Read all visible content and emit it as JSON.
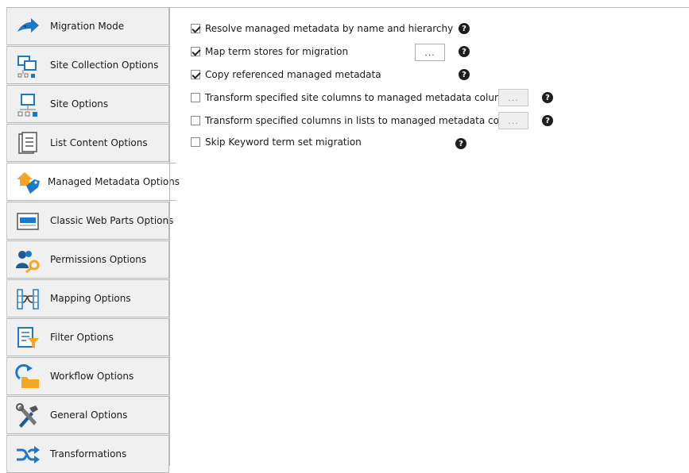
{
  "sidebar": {
    "items": [
      {
        "label": "Migration Mode",
        "icon": "arrow-forward-icon"
      },
      {
        "label": "Site Collection Options",
        "icon": "site-collection-icon"
      },
      {
        "label": "Site Options",
        "icon": "site-icon"
      },
      {
        "label": "List Content Options",
        "icon": "list-document-icon"
      },
      {
        "label": "Managed Metadata Options",
        "icon": "tag-house-icon",
        "selected": true
      },
      {
        "label": "Classic Web Parts Options",
        "icon": "web-parts-icon"
      },
      {
        "label": "Permissions Options",
        "icon": "users-key-icon"
      },
      {
        "label": "Mapping Options",
        "icon": "mapping-icon"
      },
      {
        "label": "Filter Options",
        "icon": "filter-document-icon"
      },
      {
        "label": "Workflow Options",
        "icon": "workflow-folder-icon"
      },
      {
        "label": "General Options",
        "icon": "tools-icon"
      },
      {
        "label": "Transformations",
        "icon": "shuffle-icon"
      }
    ]
  },
  "options": [
    {
      "label": "Resolve managed metadata by name and hierarchy",
      "checked": true
    },
    {
      "label": "Map term stores for migration",
      "checked": true,
      "button": "..."
    },
    {
      "label": "Copy referenced managed metadata",
      "checked": true
    },
    {
      "label": "Transform specified site columns to managed metadata columns",
      "checked": false,
      "button": "..."
    },
    {
      "label": "Transform specified columns in lists to managed metadata columns",
      "checked": false,
      "button": "..."
    },
    {
      "label": "Skip Keyword term set migration",
      "checked": false
    }
  ],
  "help_glyph": "?",
  "colors": {
    "accent_blue": "#1e78c8",
    "accent_orange": "#f5a623",
    "selected_bg": "#ffffff",
    "nav_bg": "#f0f0f0"
  }
}
